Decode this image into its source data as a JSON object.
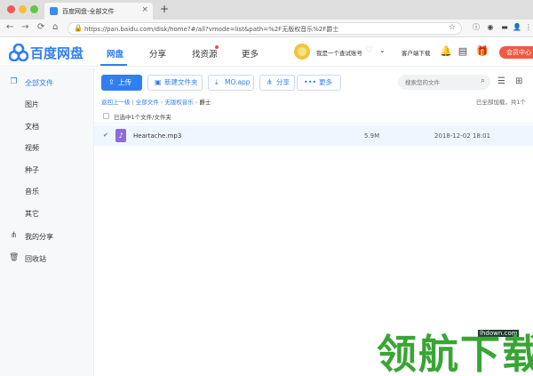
{
  "browser": {
    "tab_title": "百度网盘-全部文件",
    "tab_close": "×",
    "new_tab": "+",
    "url": "https://pan.baidu.com/disk/home?#/all?vmode=list&path=%2F无版权音乐%2F爵士"
  },
  "header": {
    "logo_text": "百度网盘",
    "nav": [
      "网盘",
      "分享",
      "找资源",
      "更多"
    ],
    "username": "我是一个查试账号",
    "client_download": "客户端下载",
    "vip_button": "会员中心"
  },
  "sidebar": {
    "items": [
      {
        "label": "全部文件",
        "icon": "folder-icon"
      },
      {
        "label": "图片"
      },
      {
        "label": "文档"
      },
      {
        "label": "视频"
      },
      {
        "label": "种子"
      },
      {
        "label": "音乐"
      },
      {
        "label": "其它"
      },
      {
        "label": "我的分享",
        "icon": "share-icon"
      },
      {
        "label": "回收站",
        "icon": "trash-icon"
      }
    ]
  },
  "toolbar": {
    "upload": "上传",
    "new_folder": "新建文件夹",
    "app": "MO.app",
    "share": "分享",
    "more": "更多",
    "search_placeholder": "搜索您的文件"
  },
  "breadcrumb": {
    "back": "返回上一级",
    "all": "全部文件",
    "folder": "无版权音乐",
    "current": "爵士",
    "status": "已全部加载，共1个"
  },
  "selection": {
    "text": "已选中1个文件/文件夹"
  },
  "files": [
    {
      "name": "Heartache.mp3",
      "size": "5.9M",
      "date": "2018-12-02 18:01"
    }
  ],
  "watermark": {
    "site": "lhdown.com",
    "text": "领航下载"
  },
  "colors": {
    "accent": "#2f7ff0",
    "vip": "#ef5a44",
    "watermark": "#3aa535"
  }
}
